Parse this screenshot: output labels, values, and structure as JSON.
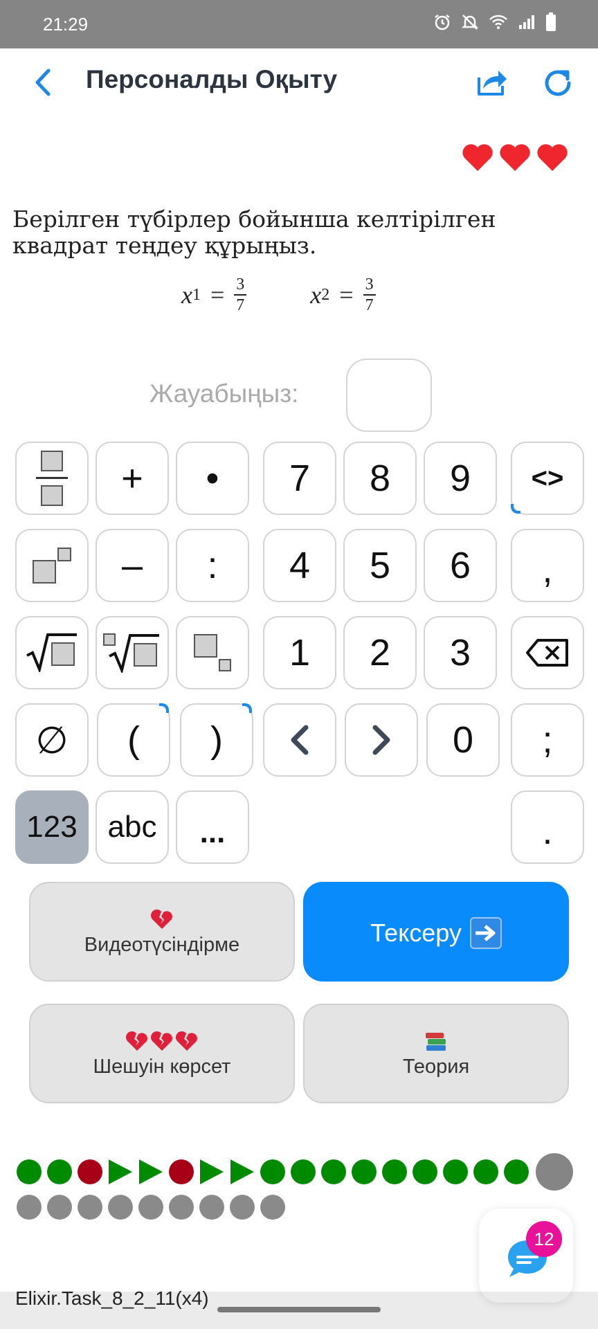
{
  "status_bar": {
    "time": "21:29",
    "icons": [
      "alarm-icon",
      "mute-icon",
      "wifi-icon",
      "signal-icon",
      "battery-icon"
    ]
  },
  "app_bar": {
    "title": "Персоналды Оқыту",
    "icons": [
      "back-icon",
      "share-icon",
      "refresh-icon"
    ],
    "accent_color": "#1e88e5"
  },
  "lives": {
    "count": 3,
    "icon": "heart-icon",
    "color": "#f0262f"
  },
  "question": {
    "text": "Берілген түбірлер бойынша келтірілген квадрат теңдеу құрыңыз.",
    "roots": [
      {
        "var": "x",
        "sub": "1",
        "eq": "=",
        "num": "3",
        "den": "7"
      },
      {
        "var": "x",
        "sub": "2",
        "eq": "=",
        "num": "3",
        "den": "7"
      }
    ]
  },
  "answer": {
    "label": "Жауабыңыз:",
    "value": ""
  },
  "keyboard": {
    "row1": {
      "plus": "+",
      "dot": "•",
      "k7": "7",
      "k8": "8",
      "k9": "9",
      "toggle": "<>"
    },
    "row2": {
      "minus": "–",
      "colon": ":",
      "k4": "4",
      "k5": "5",
      "k6": "6",
      "comma": ","
    },
    "row3": {
      "k1": "1",
      "k2": "2",
      "k3": "3"
    },
    "row4": {
      "empty_set": "∅",
      "lparen": "(",
      "rparen": ")",
      "k0": "0",
      "semicolon": ";"
    },
    "row5": {
      "num_mode": "123",
      "abc_mode": "abc",
      "more": "...",
      "period": "."
    },
    "icons": [
      "fraction-icon",
      "power-icon",
      "sqrt-icon",
      "nth-root-icon",
      "subscript-icon",
      "backspace-icon",
      "cursor-left-icon",
      "cursor-right-icon"
    ]
  },
  "actions": {
    "video": {
      "label": "Видеотүсіндірме",
      "icon": "broken-heart-icon"
    },
    "check": {
      "label": "Тексеру",
      "icon": "right-arrow-icon",
      "color": "#0a8bfb"
    },
    "solution": {
      "label": "Шешуін көрсет",
      "icon": "broken-heart-icon"
    },
    "theory": {
      "label": "Теория",
      "icon": "books-icon"
    }
  },
  "progress": {
    "row1": [
      "done",
      "done",
      "wrong",
      "skipped",
      "skipped",
      "wrong",
      "skipped",
      "skipped",
      "done",
      "done",
      "done",
      "done",
      "done",
      "done",
      "done",
      "done",
      "done",
      "current"
    ],
    "row2": [
      "pending",
      "pending",
      "pending",
      "pending",
      "pending",
      "pending",
      "pending",
      "pending",
      "pending"
    ],
    "colors": {
      "done": "#008a00",
      "wrong": "#a80017",
      "pending": "#8a8a8a"
    }
  },
  "chat": {
    "badge": "12",
    "icon": "chat-icon"
  },
  "task_id": "Elixir.Task_8_2_11(x4)"
}
